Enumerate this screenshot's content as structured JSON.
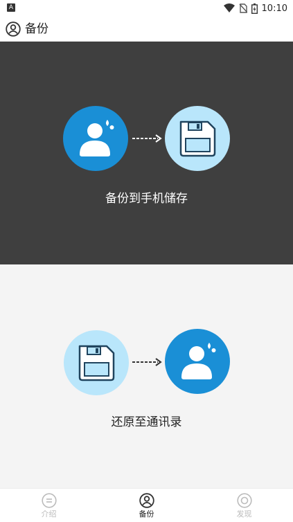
{
  "status_bar": {
    "time": "10:10",
    "left_icon": "A"
  },
  "header": {
    "title": "备份",
    "icon": "user-circle-icon"
  },
  "backup": {
    "label": "备份到手机储存",
    "from_icon": "person-icon",
    "to_icon": "floppy-disk-icon"
  },
  "restore": {
    "label": "还原至通讯录",
    "from_icon": "floppy-disk-icon",
    "to_icon": "person-icon"
  },
  "nav": {
    "items": [
      {
        "label": "介绍",
        "icon": "menu-circle-icon",
        "active": false
      },
      {
        "label": "备份",
        "icon": "user-circle-icon",
        "active": true
      },
      {
        "label": "发现",
        "icon": "target-circle-icon",
        "active": false
      }
    ]
  },
  "colors": {
    "primary_blue": "#1a8fd6",
    "light_blue": "#b9e6fb",
    "dark_panel": "#3f3f3f",
    "light_panel": "#f4f4f4"
  }
}
